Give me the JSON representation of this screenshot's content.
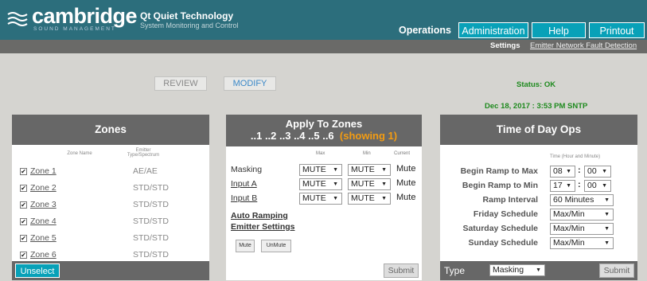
{
  "header": {
    "brand": "cambridge",
    "brand_sub": "SOUND MANAGEMENT",
    "product_title": "Qt Quiet Technology",
    "product_sub": "System Monitoring and Control",
    "tabs": [
      "Operations",
      "Administration",
      "Help",
      "Printout"
    ],
    "accent": "#08a1b8",
    "header_bg": "#2c6e7c"
  },
  "subnav": {
    "settings": "Settings",
    "emitter": "Emitter Network Fault Detection"
  },
  "actions": {
    "review": "REVIEW",
    "modify": "MODIFY"
  },
  "status": {
    "ok": "Status: OK",
    "datetime": "Dec 18, 2017 : 3:53 PM SNTP",
    "color": "#1e8a1e"
  },
  "zones": {
    "title": "Zones",
    "col_name": "Zone Name",
    "col_emitter": "Emitter Type/Spectrum",
    "rows": [
      {
        "name": "Zone 1",
        "emitter": "AE/AE",
        "checked": true
      },
      {
        "name": "Zone 2",
        "emitter": "STD/STD",
        "checked": true
      },
      {
        "name": "Zone 3",
        "emitter": "STD/STD",
        "checked": true
      },
      {
        "name": "Zone 4",
        "emitter": "STD/STD",
        "checked": true
      },
      {
        "name": "Zone 5",
        "emitter": "STD/STD",
        "checked": true
      },
      {
        "name": "Zone 6",
        "emitter": "STD/STD",
        "checked": true
      }
    ],
    "unselect": "Unselect All",
    "check_glyph": "✔"
  },
  "apply": {
    "title": "Apply To Zones",
    "zones_line": "..1 ..2 ..3 ..4 ..5 ..6",
    "showing": "(showing 1)",
    "col_max": "Max",
    "col_min": "Min",
    "col_current": "Current",
    "rows": [
      {
        "label": "Masking",
        "max": "MUTE",
        "min": "MUTE",
        "current": "Mute"
      },
      {
        "label": "Input A",
        "max": "MUTE",
        "min": "MUTE",
        "current": "Mute"
      },
      {
        "label": "Input B",
        "max": "MUTE",
        "min": "MUTE",
        "current": "Mute"
      }
    ],
    "auto_ramping": "Auto Ramping",
    "emitter_settings": "Emitter Settings",
    "mute": "Mute",
    "unmute": "UnMute",
    "submit": "Submit"
  },
  "tod": {
    "title": "Time of Day Ops",
    "col_time": "Time (Hour and Minute)",
    "begin_max": {
      "label": "Begin Ramp to Max",
      "hour": "08",
      "minute": "00"
    },
    "begin_min": {
      "label": "Begin Ramp to Min",
      "hour": "17",
      "minute": "00"
    },
    "ramp_interval": {
      "label": "Ramp Interval",
      "value": "60 Minutes"
    },
    "friday": {
      "label": "Friday Schedule",
      "value": "Max/Min"
    },
    "saturday": {
      "label": "Saturday Schedule",
      "value": "Max/Min"
    },
    "sunday": {
      "label": "Sunday Schedule",
      "value": "Max/Min"
    },
    "type_label": "Type",
    "type_value": "Masking",
    "submit": "Submit"
  },
  "icons": {
    "dropdown": "▼",
    "logo": "sound-waves-icon"
  }
}
